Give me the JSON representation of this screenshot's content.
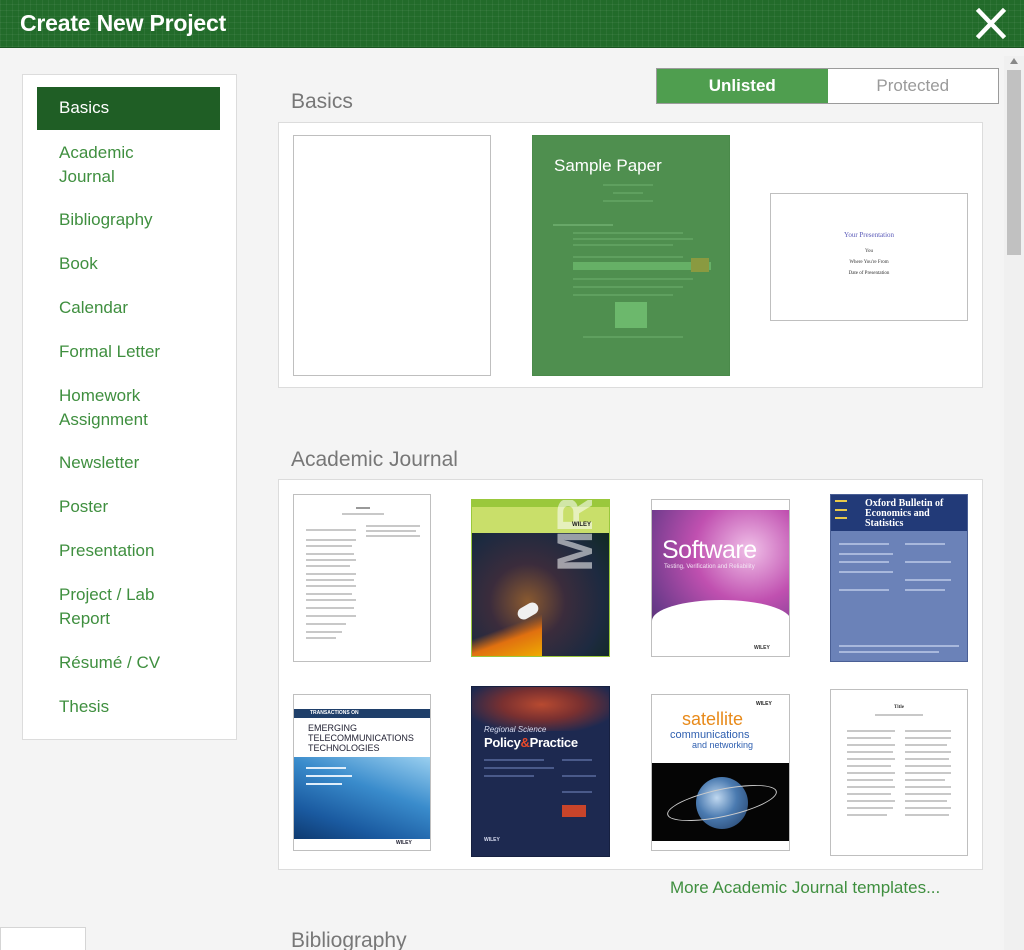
{
  "dialog": {
    "title": "Create New Project"
  },
  "sidebar": {
    "items": [
      {
        "label": "Basics",
        "active": true
      },
      {
        "label": "Academic Journal"
      },
      {
        "label": "Bibliography"
      },
      {
        "label": "Book"
      },
      {
        "label": "Calendar"
      },
      {
        "label": "Formal Letter"
      },
      {
        "label": "Homework Assignment"
      },
      {
        "label": "Newsletter"
      },
      {
        "label": "Poster"
      },
      {
        "label": "Presentation"
      },
      {
        "label": "Project / Lab Report"
      },
      {
        "label": "Résumé / CV"
      },
      {
        "label": "Thesis"
      }
    ]
  },
  "visibility": {
    "options": [
      "Unlisted",
      "Protected"
    ],
    "selected": "Unlisted"
  },
  "sections": {
    "basics": {
      "heading": "Basics",
      "templates": {
        "sample_paper": {
          "title": "Sample Paper"
        },
        "presentation": {
          "title": "Your Presentation",
          "lines": [
            "You",
            "Where You're From",
            "Date of Presentation"
          ]
        }
      }
    },
    "academic_journal": {
      "heading": "Academic Journal",
      "templates": {
        "mrc": {
          "title": "MRC",
          "publisher": "WILEY"
        },
        "software": {
          "title": "Software",
          "subtitle": "Testing, Verification and Reliability",
          "publisher": "WILEY"
        },
        "oxford": {
          "title": "Oxford Bulletin of Economics and Statistics"
        },
        "ett": {
          "title": "EMERGING TELECOMMUNICATIONS TECHNOLOGIES",
          "kicker": "TRANSACTIONS ON",
          "publisher": "WILEY"
        },
        "regional": {
          "kicker": "Regional Science",
          "title_a": "Policy",
          "title_amp": "&",
          "title_b": "Practice",
          "publisher": "WILEY"
        },
        "satellite": {
          "title": "satellite",
          "subtitle_1": "communications",
          "subtitle_2": "and networking",
          "publisher": "WILEY"
        },
        "thesis_doc": {
          "title": "Title"
        }
      },
      "more_link": "More Academic Journal templates..."
    },
    "bibliography": {
      "heading": "Bibliography"
    }
  },
  "colors": {
    "brand_green": "#226b2a",
    "accent_green": "#4f9e4f",
    "link_green": "#3f8f3f"
  }
}
